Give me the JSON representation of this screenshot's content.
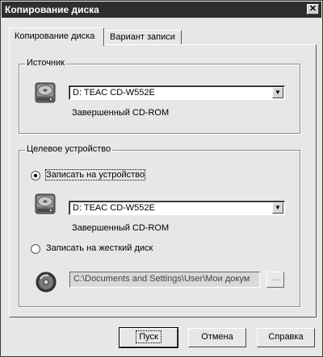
{
  "window": {
    "title": "Копирование диска",
    "close_glyph": "✕"
  },
  "tabs": [
    {
      "label": "Копирование диска",
      "active": true
    },
    {
      "label": "Вариант записи",
      "active": false
    }
  ],
  "source": {
    "legend": "Источник",
    "icon": "cd-drive-icon",
    "drive_value": "D: TEAC CD-W552E",
    "status": "Завершенный CD-ROM"
  },
  "target": {
    "legend": "Целевое устройство",
    "option_device": {
      "label": "Записать на устройство",
      "selected": true
    },
    "drive_value": "D: TEAC CD-W552E",
    "status": "Завершенный CD-ROM",
    "option_hdd": {
      "label": "Записать на жесткий диск",
      "selected": false
    },
    "path_value": "C:\\Documents and Settings\\User\\Мои докум",
    "browse_label": "..."
  },
  "buttons": {
    "start": "Пуск",
    "cancel": "Отмена",
    "help": "Справка"
  },
  "colors": {
    "titlebar": "#2e2e2e",
    "face": "#e7e7e7"
  }
}
